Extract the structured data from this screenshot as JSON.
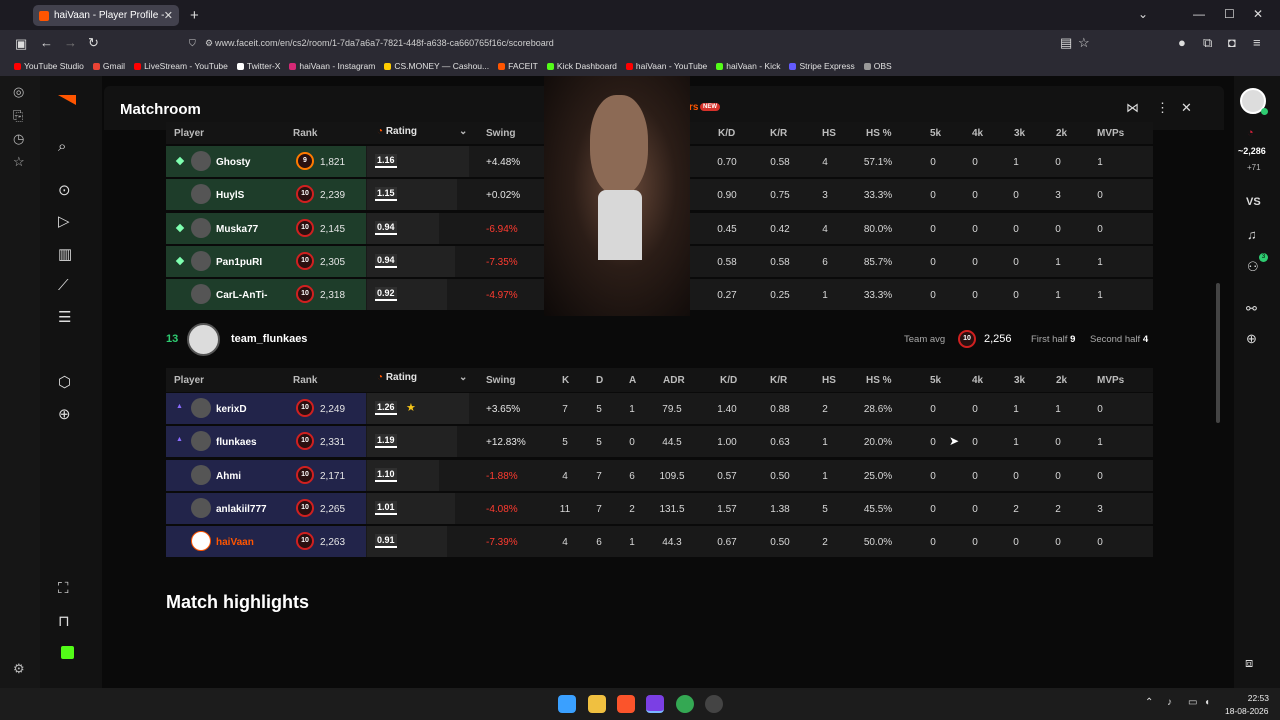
{
  "browser": {
    "tab_title": "haiVaan - Player Profile - FACEIT",
    "url": "www.faceit.com/en/cs2/room/1-7da7a6a7-7821-448f-a638-ca660765f16c/scoreboard",
    "bookmarks": [
      "YouTube Studio",
      "Gmail",
      "LiveStream - YouTube",
      "Twitter-X",
      "haiVaan - Instagram",
      "CS.MONEY — Cashou...",
      "FACEIT",
      "Kick Dashboard",
      "haiVaan - YouTube",
      "haiVaan - Kick",
      "Stripe Express",
      "OBS"
    ]
  },
  "header": {
    "title": "Matchroom",
    "new_badge": "NEW",
    "new_prefix": "rs"
  },
  "right_sidebar": {
    "elo": "~2,286",
    "elo_delta": "+71",
    "vs_label": "VS",
    "friends_count": "3"
  },
  "columns": {
    "player": "Player",
    "rank": "Rank",
    "rating": "Rating",
    "swing": "Swing",
    "k": "K",
    "d": "D",
    "a": "A",
    "adr": "ADR",
    "kd": "K/D",
    "kr": "K/R",
    "hs": "HS",
    "hsp": "HS %",
    "k5": "5k",
    "k4": "4k",
    "k3": "3k",
    "k2": "2k",
    "mvps": "MVPs"
  },
  "team1": {
    "players": [
      {
        "name": "Ghosty",
        "level": "9",
        "elo": "1,821",
        "rating": "1.16",
        "swing": "+4.48%",
        "kd": "0.70",
        "kr": "0.58",
        "hs": "4",
        "hsp": "57.1%",
        "k5": "0",
        "k4": "0",
        "k3": "1",
        "k2": "0",
        "mvps": "1"
      },
      {
        "name": "HuylS",
        "level": "10",
        "elo": "2,239",
        "rating": "1.15",
        "swing": "+0.02%",
        "kd": "0.90",
        "kr": "0.75",
        "hs": "3",
        "hsp": "33.3%",
        "k5": "0",
        "k4": "0",
        "k3": "0",
        "k2": "3",
        "mvps": "0"
      },
      {
        "name": "Muska77",
        "level": "10",
        "elo": "2,145",
        "rating": "0.94",
        "swing": "-6.94%",
        "kd": "0.45",
        "kr": "0.42",
        "hs": "4",
        "hsp": "80.0%",
        "k5": "0",
        "k4": "0",
        "k3": "0",
        "k2": "0",
        "mvps": "0"
      },
      {
        "name": "Pan1puRI",
        "level": "10",
        "elo": "2,305",
        "rating": "0.94",
        "swing": "-7.35%",
        "kd": "0.58",
        "kr": "0.58",
        "hs": "6",
        "hsp": "85.7%",
        "k5": "0",
        "k4": "0",
        "k3": "0",
        "k2": "1",
        "mvps": "1"
      },
      {
        "name": "CarL-AnTi-",
        "level": "10",
        "elo": "2,318",
        "rating": "0.92",
        "swing": "-4.97%",
        "kd": "0.27",
        "kr": "0.25",
        "hs": "1",
        "hsp": "33.3%",
        "k5": "0",
        "k4": "0",
        "k3": "0",
        "k2": "1",
        "mvps": "1"
      }
    ]
  },
  "team2": {
    "score": "13",
    "name": "team_flunkaes",
    "team_avg_label": "Team avg",
    "team_avg_level": "10",
    "team_avg_elo": "2,256",
    "first_half_label": "First half",
    "first_half": "9",
    "second_half_label": "Second half",
    "second_half": "4",
    "players": [
      {
        "name": "kerixD",
        "level": "10",
        "elo": "2,249",
        "rating": "1.26",
        "swing": "+3.65%",
        "k": "7",
        "d": "5",
        "a": "1",
        "adr": "79.5",
        "kd": "1.40",
        "kr": "0.88",
        "hs": "2",
        "hsp": "28.6%",
        "k5": "0",
        "k4": "0",
        "k3": "1",
        "k2": "1",
        "mvps": "0"
      },
      {
        "name": "flunkaes",
        "level": "10",
        "elo": "2,331",
        "rating": "1.19",
        "swing": "+12.83%",
        "k": "5",
        "d": "5",
        "a": "0",
        "adr": "44.5",
        "kd": "1.00",
        "kr": "0.63",
        "hs": "1",
        "hsp": "20.0%",
        "k5": "0",
        "k4": "0",
        "k3": "1",
        "k2": "0",
        "mvps": "1"
      },
      {
        "name": "Ahmi",
        "level": "10",
        "elo": "2,171",
        "rating": "1.10",
        "swing": "-1.88%",
        "k": "4",
        "d": "7",
        "a": "6",
        "adr": "109.5",
        "kd": "0.57",
        "kr": "0.50",
        "hs": "1",
        "hsp": "25.0%",
        "k5": "0",
        "k4": "0",
        "k3": "0",
        "k2": "0",
        "mvps": "0"
      },
      {
        "name": "anlakiil777",
        "level": "10",
        "elo": "2,265",
        "rating": "1.01",
        "swing": "-4.08%",
        "k": "11",
        "d": "7",
        "a": "2",
        "adr": "131.5",
        "kd": "1.57",
        "kr": "1.38",
        "hs": "5",
        "hsp": "45.5%",
        "k5": "0",
        "k4": "0",
        "k3": "2",
        "k2": "2",
        "mvps": "3"
      },
      {
        "name": "haiVaan",
        "level": "10",
        "elo": "2,263",
        "rating": "0.91",
        "swing": "-7.39%",
        "k": "4",
        "d": "6",
        "a": "1",
        "adr": "44.3",
        "kd": "0.67",
        "kr": "0.50",
        "hs": "2",
        "hsp": "50.0%",
        "k5": "0",
        "k4": "0",
        "k3": "0",
        "k2": "0",
        "mvps": "0"
      }
    ]
  },
  "highlights_title": "Match highlights",
  "taskbar": {
    "time": "22:53",
    "date": "18-08-2026"
  },
  "colors": {
    "accent": "#ff5500",
    "negative": "#ff3b30",
    "team1_player_bg": "#1e3d2a",
    "team2_player_bg": "#22244a"
  }
}
